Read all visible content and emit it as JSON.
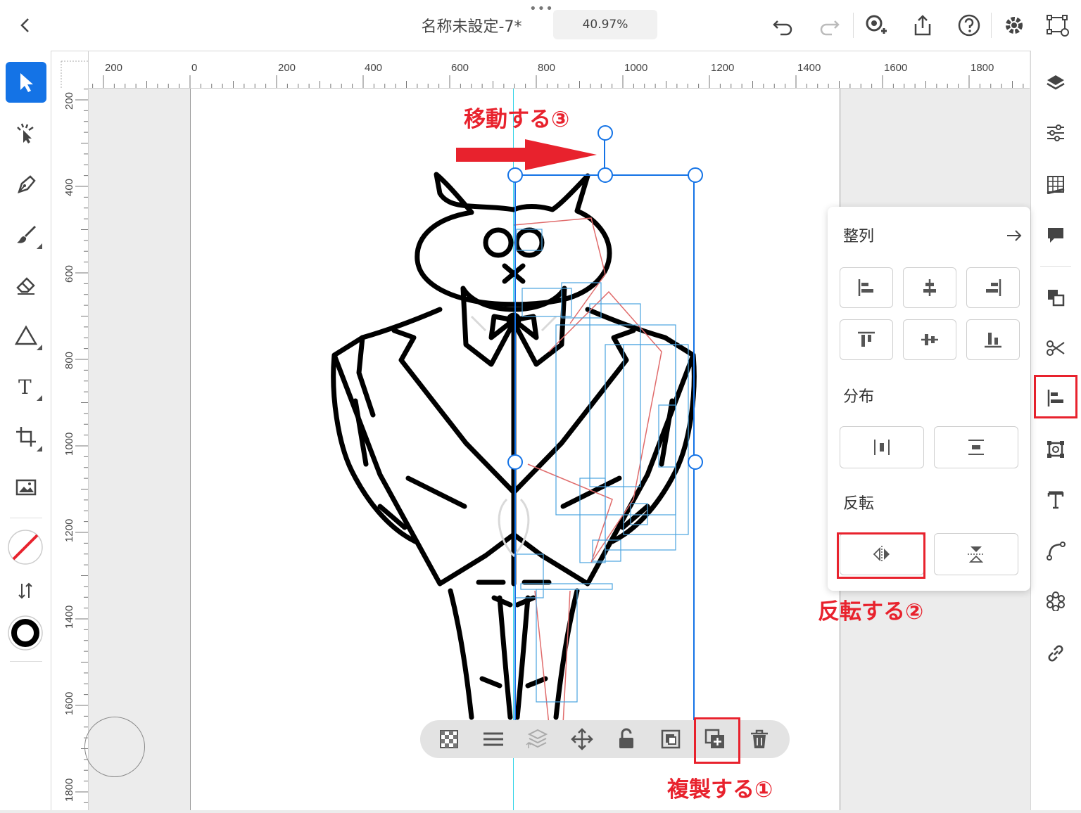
{
  "header": {
    "back_icon": "chevron-left-icon",
    "more_icon": "more-dots-icon",
    "more_glyph": "•••",
    "document_title": "名称未設定-7*",
    "zoom_level": "40.97%",
    "actions": [
      "undo-icon",
      "redo-icon",
      "invite-icon",
      "share-icon",
      "help-icon",
      "settings-icon",
      "preview-icon"
    ]
  },
  "left_toolbar": {
    "tools": [
      "selection-icon",
      "direct-selection-icon",
      "pen-icon",
      "brush-icon",
      "eraser-icon",
      "shape-icon",
      "text-icon",
      "crop-icon",
      "image-icon"
    ],
    "active_tool": "selection-icon",
    "fill_swatch": "none",
    "stroke_swatch": "#000000",
    "swap_icon": "swap-colors-icon",
    "type_glyph": "T"
  },
  "right_toolbar": {
    "tools": [
      "layers-icon",
      "properties-icon",
      "libraries-icon",
      "comments-icon",
      "arrange-icon",
      "path-icon",
      "align-icon",
      "transform-icon",
      "type-panel-icon",
      "curve-icon",
      "repeat-icon",
      "link-icon"
    ],
    "highlighted": "align-icon"
  },
  "rulers": {
    "horizontal_labels": [
      "200",
      "0",
      "200",
      "400",
      "600",
      "800",
      "1000",
      "1200",
      "1400",
      "1600",
      "1800"
    ],
    "vertical_labels": [
      "200",
      "400",
      "600",
      "800",
      "1000",
      "1200",
      "1400",
      "1600",
      "1800"
    ]
  },
  "align_panel": {
    "title": "整列",
    "expand_icon": "arrow-right-icon",
    "align_buttons": [
      "align-left-icon",
      "align-center-horizontal-icon",
      "align-right-icon",
      "align-top-icon",
      "align-center-vertical-icon",
      "align-bottom-icon"
    ],
    "distribute_title": "分布",
    "distribute_buttons": [
      "distribute-horizontal-icon",
      "distribute-vertical-icon"
    ],
    "flip_title": "反転",
    "flip_buttons": [
      "flip-horizontal-icon",
      "flip-vertical-icon"
    ]
  },
  "action_bar": {
    "buttons": [
      "transparency-icon",
      "align-menu-icon",
      "layer-order-icon",
      "move-icon",
      "lock-icon",
      "group-icon",
      "duplicate-icon",
      "delete-icon"
    ],
    "highlighted": "duplicate-icon"
  },
  "annotations": {
    "step1": "複製する①",
    "step2": "反転する②",
    "step3": "移動する③",
    "accent_color": "#e8222d"
  },
  "colors": {
    "selection_blue": "#1473e6",
    "active_tool_bg": "#1473e6"
  }
}
